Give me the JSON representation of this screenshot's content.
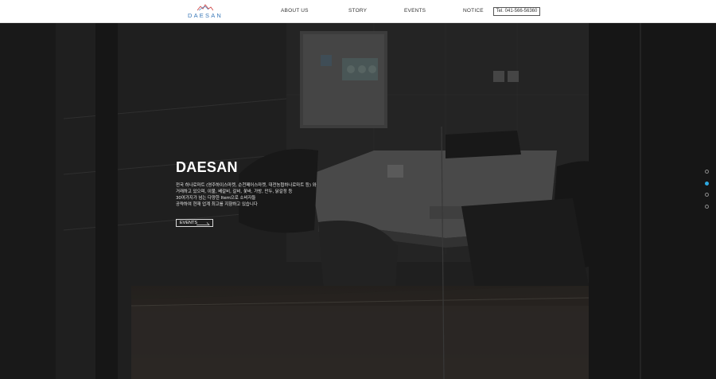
{
  "header": {
    "logo_text": "DAESAN",
    "nav": [
      {
        "label": "ABOUT US"
      },
      {
        "label": "STORY"
      },
      {
        "label": "EVENTS"
      },
      {
        "label": "NOTICE"
      }
    ],
    "tel": "Tel. 041-566-56360"
  },
  "hero": {
    "title": "DAESAN",
    "description": [
      "전국 하나로마트 (영주하이스마켓, 순천페어스마켓, 대전농협하나로마트 등) 와",
      "거래하고 있으며, 이불, 베갈비, 갈비, 꽃바, 가방, 만두, 닭갈정 등",
      "30여가지가 넘는 다양한 Item으로 소비자들",
      "공략하여 현재 업계 최고를 지향하고 있습니다"
    ],
    "button_label": "EVENTS"
  },
  "slider": {
    "total": 4,
    "active_index": 1
  },
  "colors": {
    "accent": "#2ea8e0",
    "logo": "#3a78b8",
    "header_bg": "#ffffff"
  }
}
